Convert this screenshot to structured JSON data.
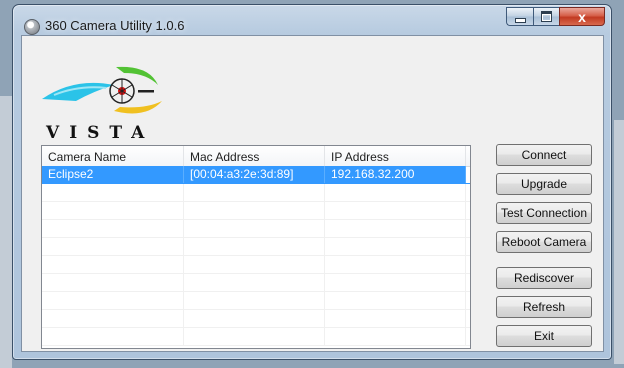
{
  "window": {
    "title": "360 Camera Utility 1.0.6",
    "close_glyph": "x"
  },
  "logo": {
    "text": "VISTA"
  },
  "list": {
    "columns": [
      "Camera Name",
      "Mac Address",
      "IP Address"
    ],
    "rows": [
      {
        "name": "Eclipse2",
        "mac": "[00:04:a3:2e:3d:89]",
        "ip": "192.168.32.200",
        "selected": true
      }
    ]
  },
  "buttons": {
    "connect": "Connect",
    "upgrade": "Upgrade",
    "test_connection": "Test Connection",
    "reboot_camera": "Reboot Camera",
    "rediscover": "Rediscover",
    "refresh": "Refresh",
    "exit": "Exit"
  },
  "colors": {
    "selection": "#3399ff",
    "close_button": "#c23a22"
  }
}
